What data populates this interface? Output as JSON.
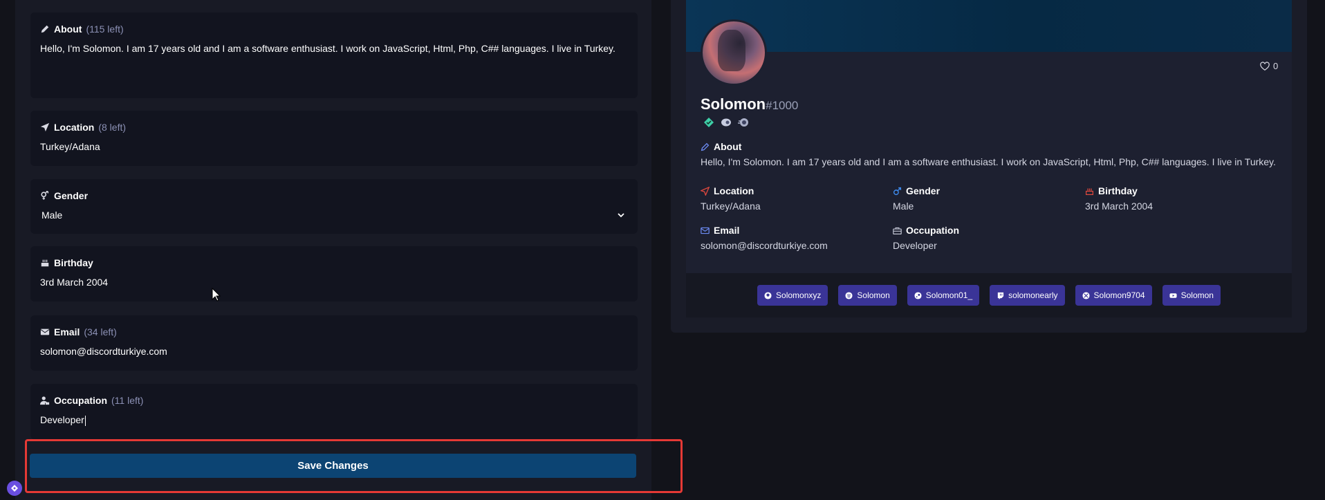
{
  "edit_form": {
    "about": {
      "label": "About",
      "remaining": "(115 left)",
      "value": "Hello, I'm Solomon. I am 17 years old and I am a software enthusiast. I work on JavaScript, Html, Php, C## languages. I live in Turkey."
    },
    "location": {
      "label": "Location",
      "remaining": "(8 left)",
      "value": "Turkey/Adana"
    },
    "gender": {
      "label": "Gender",
      "value": "Male"
    },
    "birthday": {
      "label": "Birthday",
      "value": "3rd March 2004"
    },
    "email": {
      "label": "Email",
      "remaining": "(34 left)",
      "value": "solomon@discordturkiye.com"
    },
    "occupation": {
      "label": "Occupation",
      "remaining": "(11 left)",
      "value": "Developer"
    },
    "save_label": "Save Changes"
  },
  "profile": {
    "username": "Solomon",
    "discriminator": "#1000",
    "likes": "0",
    "about_label": "About",
    "about": "Hello, I'm Solomon. I am 17 years old and I am a software enthusiast. I work on JavaScript, Html, Php, C## languages. I live in Turkey.",
    "location_label": "Location",
    "location": "Turkey/Adana",
    "gender_label": "Gender",
    "gender": "Male",
    "birthday_label": "Birthday",
    "birthday": "3rd March 2004",
    "email_label": "Email",
    "email": "solomon@discordturkiye.com",
    "occupation_label": "Occupation",
    "occupation": "Developer",
    "socials": [
      {
        "icon": "github-icon",
        "label": "Solomonxyz"
      },
      {
        "icon": "spotify-icon",
        "label": "Solomon"
      },
      {
        "icon": "steam-icon",
        "label": "Solomon01_"
      },
      {
        "icon": "twitch-icon",
        "label": "solomonearly"
      },
      {
        "icon": "xbox-icon",
        "label": "Solomon9704"
      },
      {
        "icon": "youtube-icon",
        "label": "Solomon"
      }
    ]
  },
  "colors": {
    "accent": "#3a3497",
    "save_button": "#0c4473",
    "highlight": "#e53935"
  }
}
